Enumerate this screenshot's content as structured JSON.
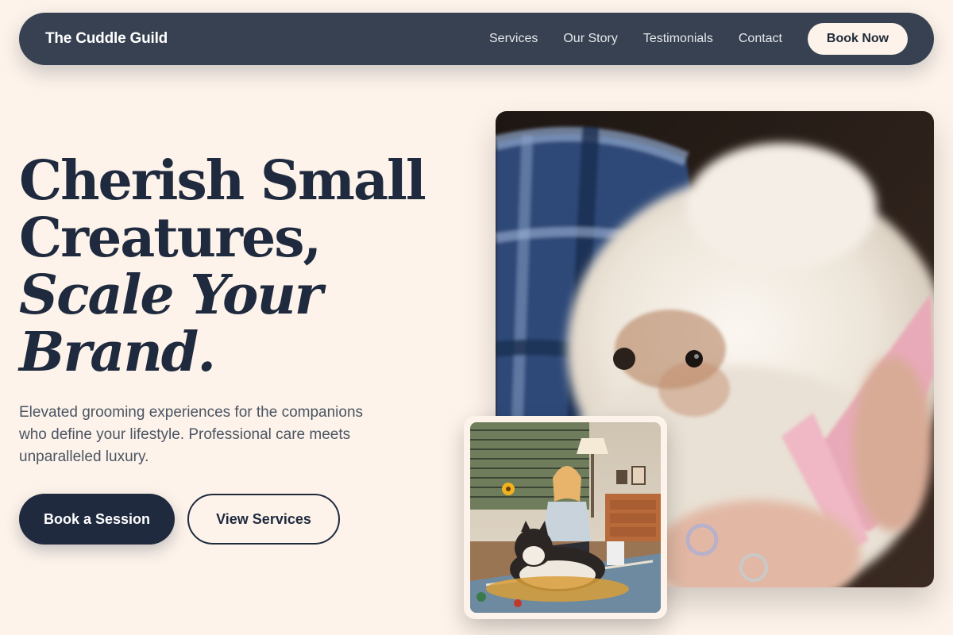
{
  "nav": {
    "brand": "The Cuddle Guild",
    "links": [
      "Services",
      "Our Story",
      "Testimonials",
      "Contact"
    ],
    "cta": "Book Now"
  },
  "hero": {
    "title_line1": "Cherish Small",
    "title_line2": "Creatures,",
    "title_line3": "Scale Your",
    "title_line4": "Brand.",
    "subtitle": "Elevated grooming experiences for the companions who define your lifestyle. Professional care meets unparalleled luxury.",
    "primary_button": "Book a Session",
    "secondary_button": "View Services"
  },
  "images": {
    "main_icon": "photo-fluffy-dog-being-brushed",
    "inset_icon": "photo-woman-with-husky-in-living-room"
  },
  "colors": {
    "background": "#fdf3ea",
    "nav": "#374151",
    "heading": "#1f2a3f",
    "body_text": "#4b5563"
  }
}
